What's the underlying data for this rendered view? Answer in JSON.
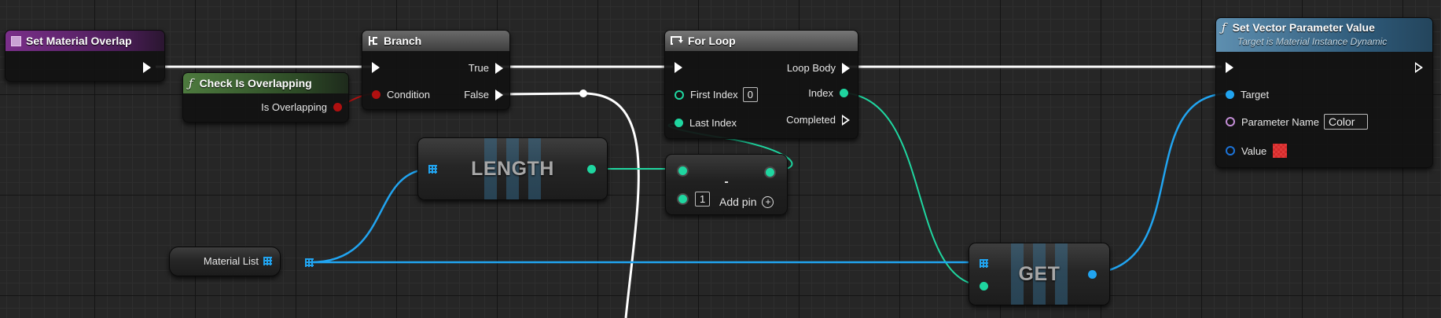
{
  "nodes": {
    "set_material_overlap": {
      "title": "Set Material Overlap"
    },
    "branch": {
      "title": "Branch",
      "true_label": "True",
      "false_label": "False",
      "condition_label": "Condition"
    },
    "check_is_overlapping": {
      "title": "Check Is Overlapping",
      "output_label": "Is Overlapping"
    },
    "for_loop": {
      "title": "For Loop",
      "first_index_label": "First Index",
      "first_index_value": "0",
      "last_index_label": "Last Index",
      "loop_body_label": "Loop Body",
      "index_label": "Index",
      "completed_label": "Completed"
    },
    "length": {
      "title": "LENGTH"
    },
    "subtract": {
      "title": "-",
      "value": "1",
      "add_pin_label": "Add pin"
    },
    "material_list": {
      "label": "Material List"
    },
    "get": {
      "title": "GET"
    },
    "set_vector_param": {
      "title": "Set Vector Parameter Value",
      "subtitle": "Target is Material Instance Dynamic",
      "target_label": "Target",
      "param_name_label": "Parameter Name",
      "param_name_value": "Color",
      "value_label": "Value"
    }
  },
  "colors": {
    "exec_wire": "#ffffff",
    "int_pin": "#1fd6a0",
    "object_pin": "#21a4f0",
    "name_pin": "#c38ed6",
    "struct_pin": "#1c73d8",
    "bool_pin": "#b01010",
    "value_swatch": "#d42b2b"
  },
  "icons": {
    "event": "event-square-icon",
    "branch": "branch-icon",
    "function": "function-icon",
    "for_loop": "loop-icon",
    "add_pin": "plus-circle-icon",
    "array": "array-grid-icon"
  }
}
